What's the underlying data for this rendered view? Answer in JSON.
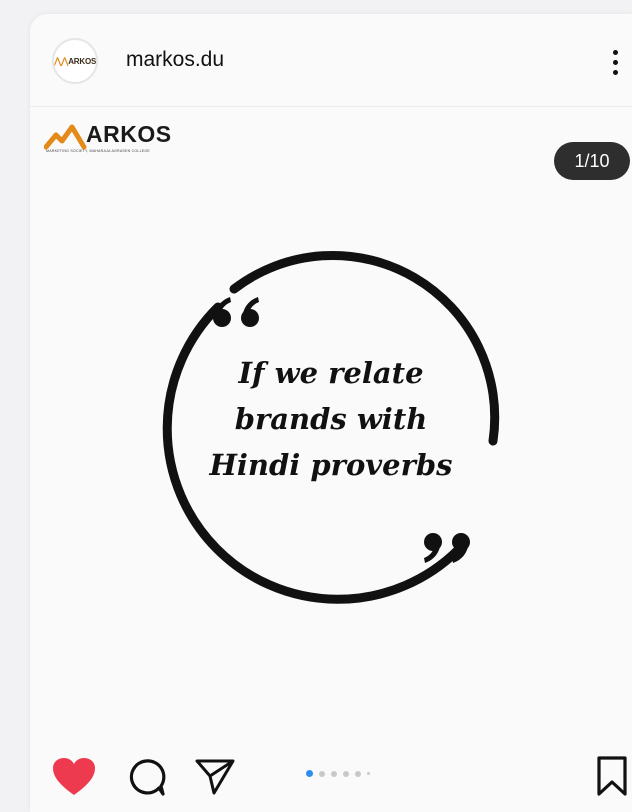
{
  "post": {
    "username": "markos.du",
    "avatar_text": "ARKOS",
    "more_icon": "more-vertical-icon"
  },
  "media": {
    "brand_name": "ARKOS",
    "brand_tagline": "MARKETING SOCIETY, MAHARAJA AGRASEN COLLEGE",
    "counter": "1/10",
    "quote_lines": [
      "If we relate",
      "brands with",
      "Hindi proverbs"
    ]
  },
  "actions": {
    "like_icon": "heart-icon",
    "comment_icon": "comment-icon",
    "share_icon": "send-icon",
    "save_icon": "bookmark-icon",
    "liked": true,
    "carousel_current": 1,
    "carousel_total": 10
  },
  "colors": {
    "like": "#ee3a4f",
    "dot_active": "#2e8ef0",
    "counter_bg": "#2e2e2e",
    "brand_accent": "#e38a18"
  }
}
